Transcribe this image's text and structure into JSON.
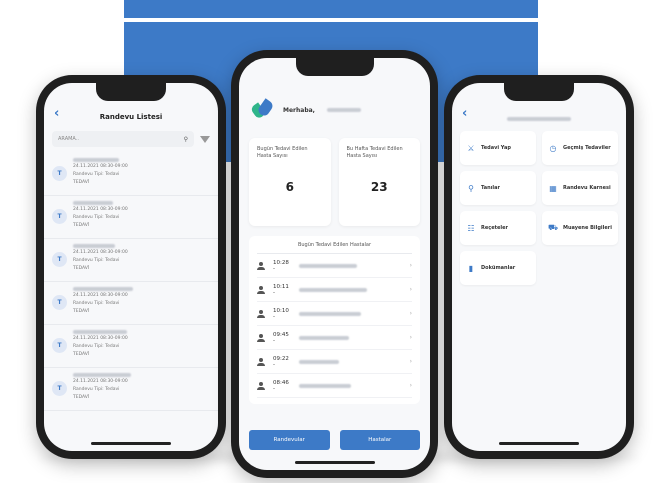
{
  "left_screen": {
    "title": "Randevu Listesi",
    "search_placeholder": "ARAMA..",
    "items": [
      {
        "avatar": "T",
        "date": "24.11.2021 08:30-09:00",
        "type": "Randevu Tipi: Tedavi",
        "status": "TEDAVİ"
      },
      {
        "avatar": "T",
        "date": "24.11.2021 08:30-09:00",
        "type": "Randevu Tipi: Tedavi",
        "status": "TEDAVİ"
      },
      {
        "avatar": "T",
        "date": "24.11.2021 08:30-09:00",
        "type": "Randevu Tipi: Tedavi",
        "status": "TEDAVİ"
      },
      {
        "avatar": "T",
        "date": "24.11.2021 08:30-09:00",
        "type": "Randevu Tipi: Tedavi",
        "status": "TEDAVİ"
      },
      {
        "avatar": "T",
        "date": "24.11.2021 08:30-09:00",
        "type": "Randevu Tipi: Tedavi",
        "status": "TEDAVİ"
      },
      {
        "avatar": "T",
        "date": "24.11.2021 08:30-09:00",
        "type": "Randevu Tipi: Tedavi",
        "status": "TEDAVİ"
      }
    ]
  },
  "center_screen": {
    "greeting": "Merhaba,",
    "stats": [
      {
        "label": "Bugün Tedavi Edilen Hasta Sayısı",
        "value": "6"
      },
      {
        "label": "Bu Hafta Tedavi Edilen Hasta Sayısı",
        "value": "23"
      }
    ],
    "section_title": "Bugün Tedavi Edilen Hastalar",
    "appointments": [
      {
        "time": "10:28 -"
      },
      {
        "time": "10:11 -"
      },
      {
        "time": "10:10 -"
      },
      {
        "time": "09:45 -"
      },
      {
        "time": "09:22 -"
      },
      {
        "time": "08:46 -"
      }
    ],
    "buttons": {
      "left": "Randevular",
      "right": "Hastalar"
    }
  },
  "right_screen": {
    "menu": [
      {
        "label": "Tedavi Yap",
        "icon": "tooth-icon"
      },
      {
        "label": "Geçmiş Tedaviler",
        "icon": "clock-icon"
      },
      {
        "label": "Tanılar",
        "icon": "search-icon"
      },
      {
        "label": "Randevu Karnesi",
        "icon": "calendar-icon"
      },
      {
        "label": "Reçeteler",
        "icon": "prescription-icon"
      },
      {
        "label": "Muayene Bilgileri",
        "icon": "medical-bag-icon"
      },
      {
        "label": "Dokümanlar",
        "icon": "document-icon"
      }
    ]
  },
  "colors": {
    "accent": "#3d7ac7",
    "brand_green": "#2fb58a"
  }
}
